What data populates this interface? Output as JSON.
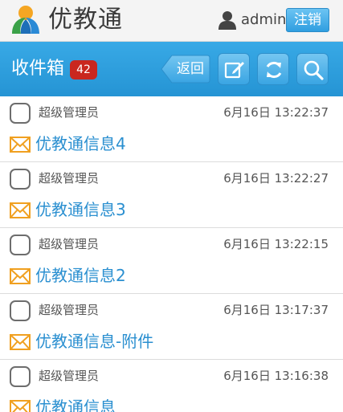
{
  "header": {
    "brand": "优教通",
    "username": "admin",
    "logout_label": "注销"
  },
  "titlebar": {
    "title": "收件箱",
    "unread_count": "42",
    "back_label": "返回"
  },
  "messages": [
    {
      "sender": "超级管理员",
      "time": "6月16日 13:22:37",
      "subject": "优教通信息4"
    },
    {
      "sender": "超级管理员",
      "time": "6月16日 13:22:27",
      "subject": "优教通信息3"
    },
    {
      "sender": "超级管理员",
      "time": "6月16日 13:22:15",
      "subject": "优教通信息2"
    },
    {
      "sender": "超级管理员",
      "time": "6月16日 13:17:37",
      "subject": "优教通信息-附件"
    },
    {
      "sender": "超级管理员",
      "time": "6月16日 13:16:38",
      "subject": "优教通信息"
    }
  ],
  "colors": {
    "accent": "#2a9ad9",
    "badge": "#c9271f",
    "subject": "#2a8fd0",
    "mail_icon": "#f0a020"
  }
}
